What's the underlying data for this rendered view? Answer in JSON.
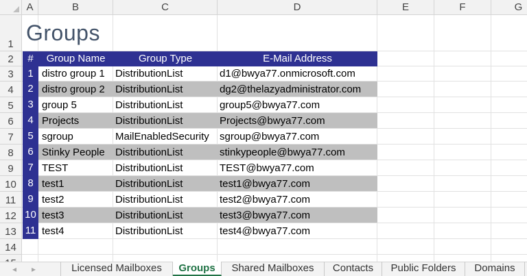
{
  "columns": [
    "A",
    "B",
    "C",
    "D",
    "E",
    "F",
    "G"
  ],
  "rows": [
    "1",
    "2",
    "3",
    "4",
    "5",
    "6",
    "7",
    "8",
    "9",
    "10",
    "11",
    "12",
    "13",
    "14",
    "15"
  ],
  "sheet_title": "Groups",
  "table": {
    "headers": [
      "#",
      "Group Name",
      "Group Type",
      "E-Mail Address"
    ],
    "rows": [
      {
        "num": "1",
        "name": "distro group 1",
        "type": "DistributionList",
        "email": "d1@bwya77.onmicrosoft.com"
      },
      {
        "num": "2",
        "name": "distro group 2",
        "type": "DistributionList",
        "email": "dg2@thelazyadministrator.com"
      },
      {
        "num": "3",
        "name": "group 5",
        "type": "DistributionList",
        "email": "group5@bwya77.com"
      },
      {
        "num": "4",
        "name": "Projects",
        "type": "DistributionList",
        "email": "Projects@bwya77.com"
      },
      {
        "num": "5",
        "name": "sgroup",
        "type": "MailEnabledSecurity",
        "email": "sgroup@bwya77.com"
      },
      {
        "num": "6",
        "name": "Stinky People",
        "type": "DistributionList",
        "email": "stinkypeople@bwya77.com"
      },
      {
        "num": "7",
        "name": "TEST",
        "type": "DistributionList",
        "email": "TEST@bwya77.com"
      },
      {
        "num": "8",
        "name": "test1",
        "type": "DistributionList",
        "email": "test1@bwya77.com"
      },
      {
        "num": "9",
        "name": "test2",
        "type": "DistributionList",
        "email": "test2@bwya77.com"
      },
      {
        "num": "10",
        "name": "test3",
        "type": "DistributionList",
        "email": "test3@bwya77.com"
      },
      {
        "num": "11",
        "name": "test4",
        "type": "DistributionList",
        "email": "test4@bwya77.com"
      }
    ]
  },
  "tabs": [
    {
      "label": "Licensed Mailboxes",
      "active": false
    },
    {
      "label": "Groups",
      "active": true
    },
    {
      "label": "Shared Mailboxes",
      "active": false
    },
    {
      "label": "Contacts",
      "active": false
    },
    {
      "label": "Public Folders",
      "active": false
    },
    {
      "label": "Domains",
      "active": false
    }
  ],
  "nav": {
    "prev_icon": "◂",
    "next_icon": "▸"
  },
  "colors": {
    "header_fill": "#2e3192",
    "band_fill": "#bfbfbf",
    "title_color": "#44546a",
    "active_tab": "#217346"
  }
}
